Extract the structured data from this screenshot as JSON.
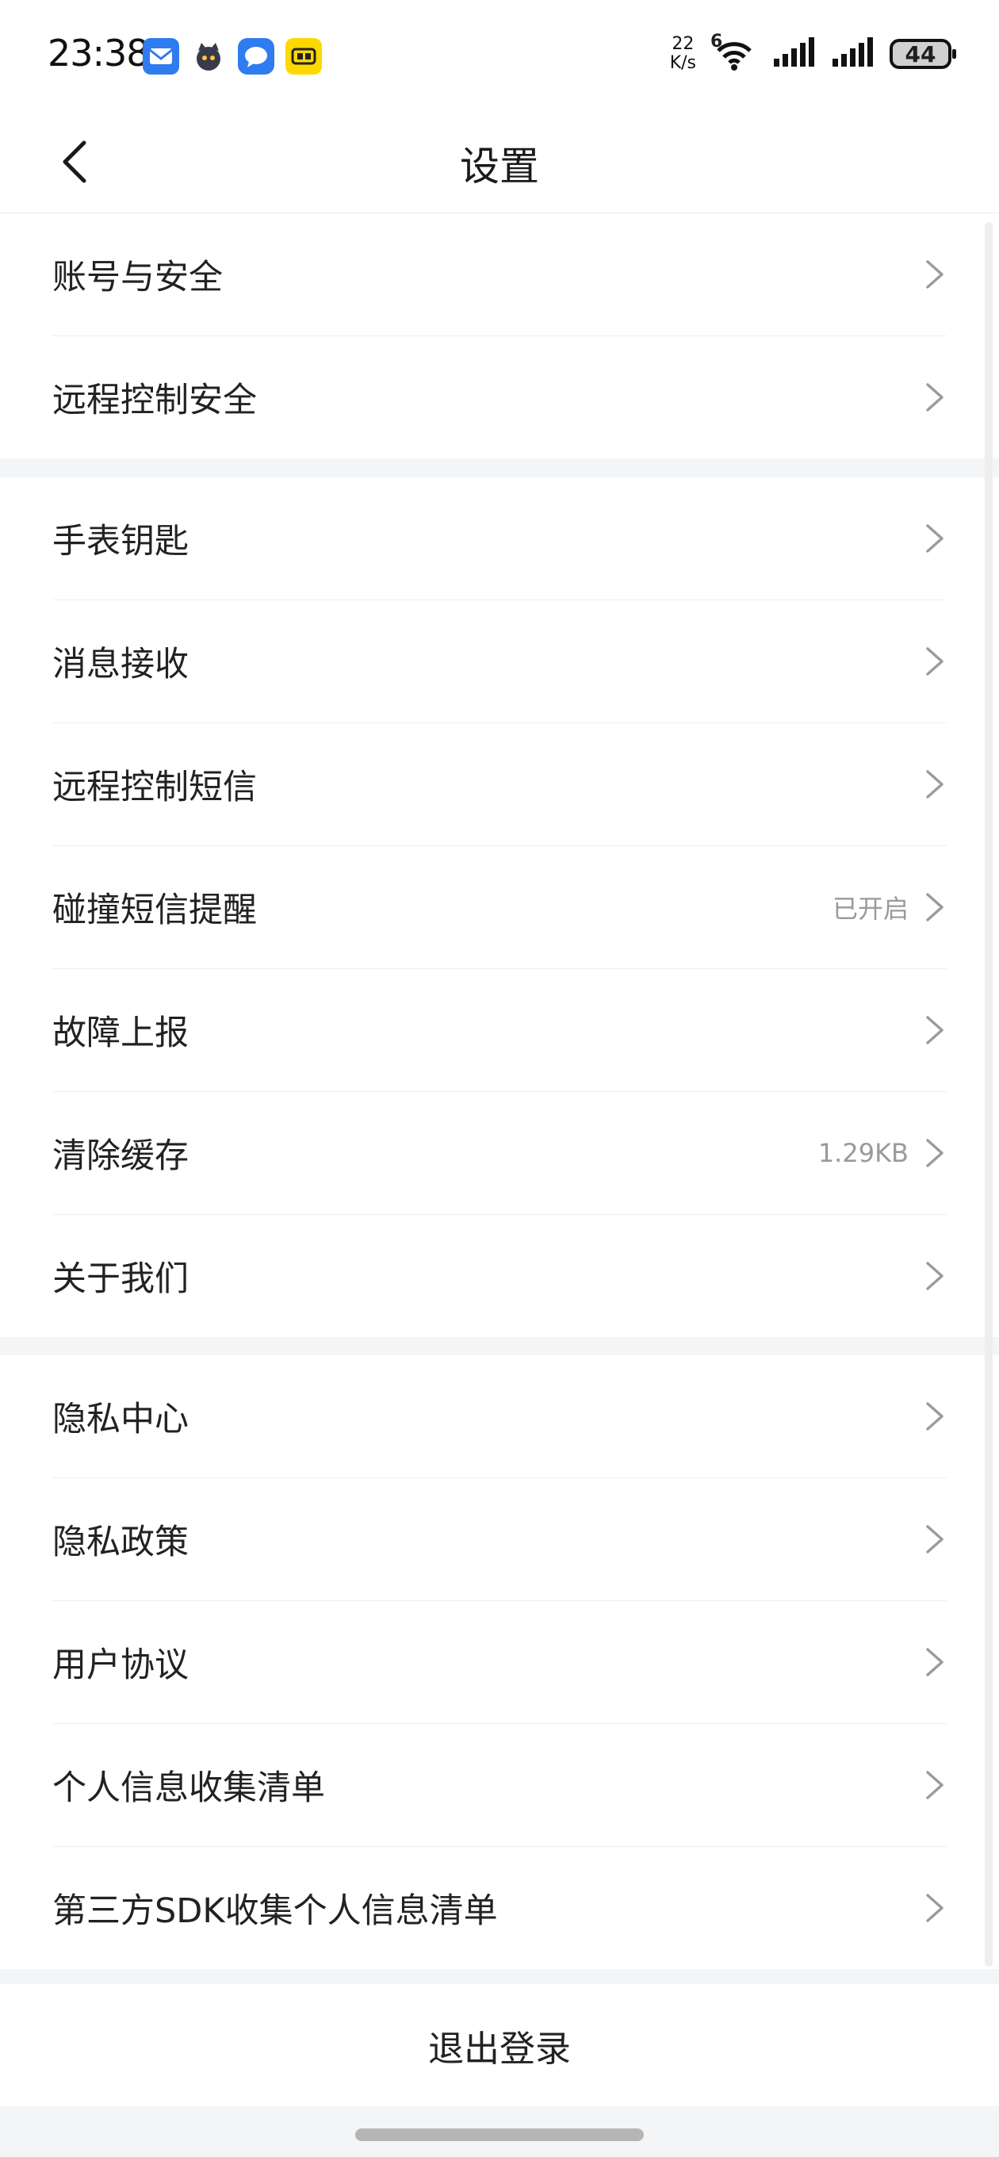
{
  "status_bar": {
    "time": "23:38",
    "net_speed_value": "22",
    "net_speed_unit": "K/s",
    "wifi_label": "6",
    "battery": "44",
    "notification_icons": [
      "mail-icon",
      "cat-app-icon",
      "chat-icon",
      "xianyu-app-icon"
    ]
  },
  "header": {
    "title": "设置",
    "back_icon": "chevron-left-icon"
  },
  "groups": [
    [
      {
        "label": "账号与安全",
        "value": ""
      },
      {
        "label": "远程控制安全",
        "value": ""
      }
    ],
    [
      {
        "label": "手表钥匙",
        "value": ""
      },
      {
        "label": "消息接收",
        "value": ""
      },
      {
        "label": "远程控制短信",
        "value": ""
      },
      {
        "label": "碰撞短信提醒",
        "value": "已开启"
      },
      {
        "label": "故障上报",
        "value": ""
      },
      {
        "label": "清除缓存",
        "value": "1.29KB"
      },
      {
        "label": "关于我们",
        "value": ""
      }
    ],
    [
      {
        "label": "隐私中心",
        "value": ""
      },
      {
        "label": "隐私政策",
        "value": ""
      },
      {
        "label": "用户协议",
        "value": ""
      },
      {
        "label": "个人信息收集清单",
        "value": ""
      },
      {
        "label": "第三方SDK收集个人信息清单",
        "value": ""
      }
    ]
  ],
  "logout_label": "退出登录",
  "colors": {
    "background": "#f4f5f7",
    "card": "#ffffff",
    "text": "#222222",
    "secondary_text": "#9a9a9a"
  }
}
